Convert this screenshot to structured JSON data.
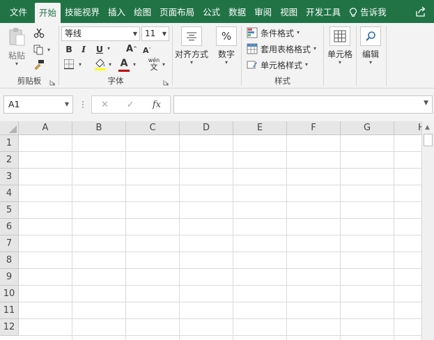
{
  "tabs": [
    {
      "label": "文件",
      "active": false
    },
    {
      "label": "开始",
      "active": true
    },
    {
      "label": "技能视界",
      "active": false
    },
    {
      "label": "插入",
      "active": false
    },
    {
      "label": "绘图",
      "active": false
    },
    {
      "label": "页面布局",
      "active": false
    },
    {
      "label": "公式",
      "active": false
    },
    {
      "label": "数据",
      "active": false
    },
    {
      "label": "审阅",
      "active": false
    },
    {
      "label": "视图",
      "active": false
    },
    {
      "label": "开发工具",
      "active": false
    }
  ],
  "tell_me": "告诉我",
  "ribbon": {
    "clipboard": {
      "paste_label": "粘贴",
      "group_label": "剪贴板"
    },
    "font": {
      "font_name": "等线",
      "font_size": "11",
      "group_label": "字体"
    },
    "alignment": {
      "label": "对齐方式"
    },
    "number": {
      "label": "数字"
    },
    "styles": {
      "conditional": "条件格式",
      "table_format": "套用表格格式",
      "cell_styles": "单元格样式",
      "group_label": "样式"
    },
    "cells": {
      "label": "单元格"
    },
    "editing": {
      "label": "编辑"
    }
  },
  "formula_bar": {
    "name_box": "A1",
    "formula": ""
  },
  "columns": [
    "A",
    "B",
    "C",
    "D",
    "E",
    "F",
    "G",
    "H"
  ],
  "rows": [
    "1",
    "2",
    "3",
    "4",
    "5",
    "6",
    "7",
    "8",
    "9",
    "10",
    "11",
    "12"
  ],
  "colors": {
    "excel_green": "#217346",
    "fill_yellow": "#ffff00",
    "font_red": "#c00000"
  }
}
